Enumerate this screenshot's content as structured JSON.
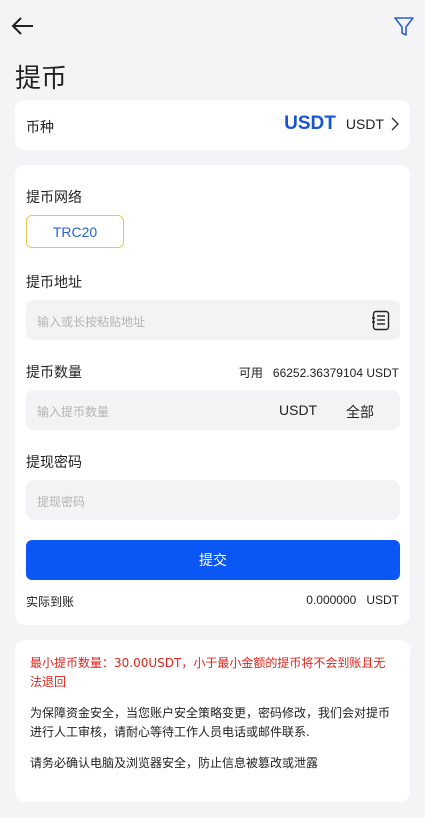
{
  "page": {
    "title": "提币"
  },
  "coin": {
    "label": "币种",
    "value_big": "USDT",
    "value_small": "USDT"
  },
  "form": {
    "network_label": "提币网络",
    "network_option": "TRC20",
    "address_label": "提币地址",
    "address_placeholder": "输入或长按粘贴地址",
    "amount_label": "提币数量",
    "available_label": "可用",
    "available_value": "66252.36379104 USDT",
    "amount_placeholder": "输入提币数量",
    "amount_unit": "USDT",
    "all_label": "全部",
    "password_label": "提现密码",
    "password_placeholder": "提现密码",
    "submit_label": "提交",
    "arrival_label": "实际到账",
    "arrival_value": "0.000000",
    "arrival_unit": "USDT"
  },
  "notes": {
    "line1": "最小提币数量：30.00USDT，小于最小金额的提币将不会到账且无法退回",
    "line2": "为保障资金安全，当您账户安全策略变更，密码修改，我们会对提币进行人工审核，请耐心等待工作人员电话或邮件联系.",
    "line3": "请务必确认电脑及浏览器安全，防止信息被篡改或泄露"
  },
  "colors": {
    "accent": "#0b57f6",
    "network_border": "#e6c84e",
    "warning": "#e0231c"
  },
  "icons": {
    "back": "arrow-left-icon",
    "filter": "filter-icon",
    "chevron": "chevron-right-icon",
    "paste": "clipboard-icon"
  }
}
